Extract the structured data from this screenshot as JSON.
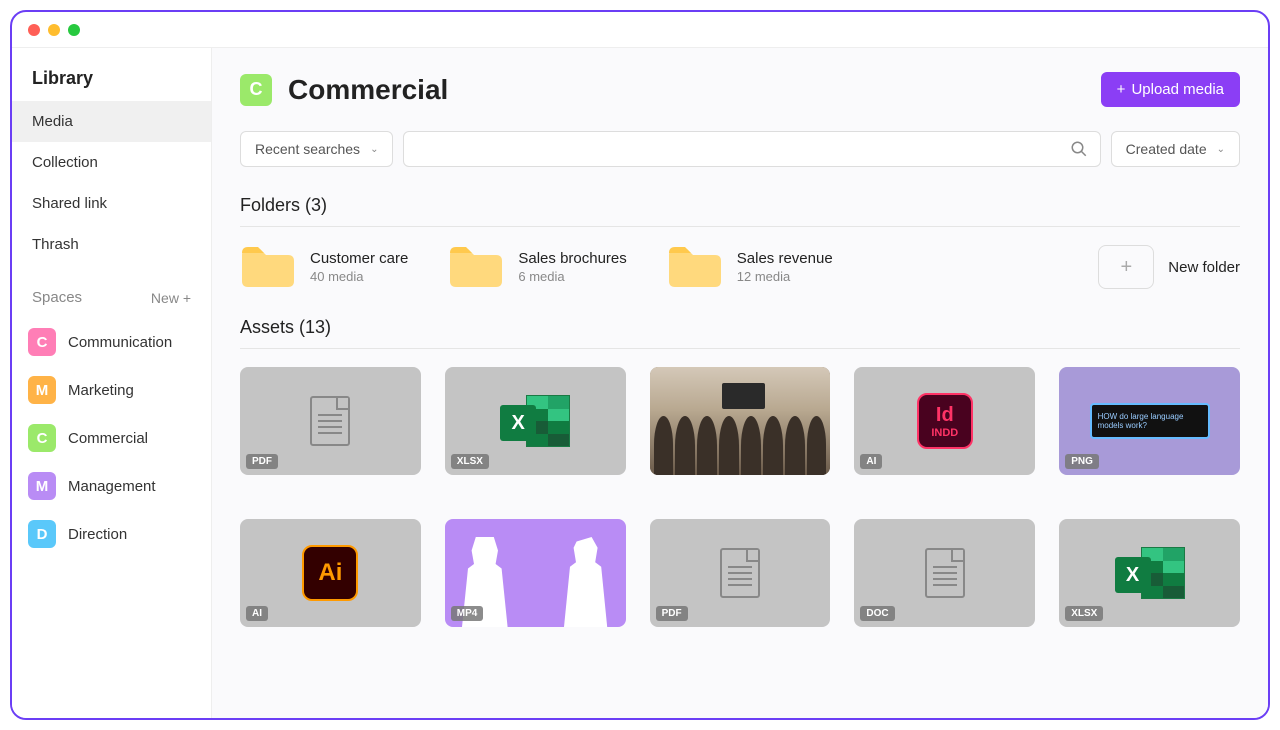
{
  "sidebar": {
    "title": "Library",
    "nav": [
      {
        "label": "Media",
        "active": true
      },
      {
        "label": "Collection",
        "active": false
      },
      {
        "label": "Shared link",
        "active": false
      },
      {
        "label": "Thrash",
        "active": false
      }
    ],
    "spaces_title": "Spaces",
    "spaces_new": "New +",
    "spaces": [
      {
        "letter": "C",
        "label": "Communication",
        "color": "#ff7eb6"
      },
      {
        "letter": "M",
        "label": "Marketing",
        "color": "#ffb347"
      },
      {
        "letter": "C",
        "label": "Commercial",
        "color": "#9be96a"
      },
      {
        "letter": "M",
        "label": "Management",
        "color": "#b98cf5"
      },
      {
        "letter": "D",
        "label": "Direction",
        "color": "#5ac8fa"
      }
    ]
  },
  "header": {
    "badge_letter": "C",
    "badge_color": "#9be96a",
    "title": "Commercial",
    "upload_label": "Upload media"
  },
  "search": {
    "recent_label": "Recent searches",
    "placeholder": "",
    "sort_label": "Created date"
  },
  "folders": {
    "title": "Folders (3)",
    "items": [
      {
        "name": "Customer care",
        "meta": "40 media"
      },
      {
        "name": "Sales brochures",
        "meta": "6 media"
      },
      {
        "name": "Sales revenue",
        "meta": "12 media"
      }
    ],
    "new_label": "New folder"
  },
  "assets": {
    "title": "Assets (13)",
    "items": [
      {
        "tag": "PDF",
        "kind": "doc",
        "bg": "gray"
      },
      {
        "tag": "XLSX",
        "kind": "excel",
        "bg": "gray"
      },
      {
        "tag": "",
        "kind": "photo",
        "bg": "photo"
      },
      {
        "tag": "AI",
        "kind": "indd",
        "bg": "gray"
      },
      {
        "tag": "PNG",
        "kind": "screen",
        "bg": "purplelight"
      },
      {
        "tag": "AI",
        "kind": "ai",
        "bg": "gray"
      },
      {
        "tag": "MP4",
        "kind": "silhouette",
        "bg": "purple"
      },
      {
        "tag": "PDF",
        "kind": "doc",
        "bg": "gray"
      },
      {
        "tag": "DOC",
        "kind": "doc",
        "bg": "gray"
      },
      {
        "tag": "XLSX",
        "kind": "excel",
        "bg": "gray"
      }
    ]
  },
  "screen_text": {
    "l1": "HOW do large language",
    "l2": "models work?"
  }
}
